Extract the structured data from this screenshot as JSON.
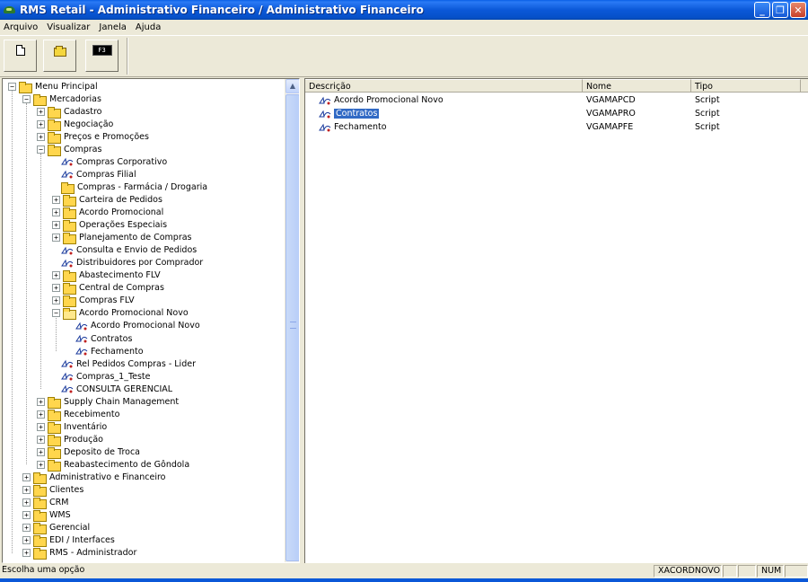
{
  "window": {
    "title": "RMS Retail - Administrativo Financeiro / Administrativo Financeiro",
    "minimize_glyph": "_",
    "maximize_glyph": "❐",
    "close_glyph": "✕"
  },
  "menubar": {
    "items": [
      "Arquivo",
      "Visualizar",
      "Janela",
      "Ajuda"
    ]
  },
  "toolbar": {
    "f3_label": "F3"
  },
  "tree": {
    "expand_glyph": "+",
    "collapse_glyph": "−",
    "scroll_up_glyph": "▲",
    "items": [
      {
        "label": "Menu Principal",
        "level": 0,
        "kind": "folder",
        "state": "expanded"
      },
      {
        "label": "Mercadorias",
        "level": 1,
        "kind": "folder",
        "state": "expanded"
      },
      {
        "label": "Cadastro",
        "level": 2,
        "kind": "folder",
        "state": "collapsed"
      },
      {
        "label": "Negociação",
        "level": 2,
        "kind": "folder",
        "state": "collapsed"
      },
      {
        "label": "Preços e Promoções",
        "level": 2,
        "kind": "folder",
        "state": "collapsed"
      },
      {
        "label": "Compras",
        "level": 2,
        "kind": "folder",
        "state": "expanded"
      },
      {
        "label": "Compras Corporativo",
        "level": 3,
        "kind": "script",
        "state": "leaf"
      },
      {
        "label": "Compras Filial",
        "level": 3,
        "kind": "script",
        "state": "leaf"
      },
      {
        "label": "Compras - Farmácia / Drogaria",
        "level": 3,
        "kind": "folder",
        "state": "leaf"
      },
      {
        "label": "Carteira de Pedidos",
        "level": 3,
        "kind": "folder",
        "state": "collapsed"
      },
      {
        "label": "Acordo Promocional",
        "level": 3,
        "kind": "folder",
        "state": "collapsed"
      },
      {
        "label": "Operações Especiais",
        "level": 3,
        "kind": "folder",
        "state": "collapsed"
      },
      {
        "label": "Planejamento de Compras",
        "level": 3,
        "kind": "folder",
        "state": "collapsed"
      },
      {
        "label": "Consulta e Envio de Pedidos",
        "level": 3,
        "kind": "script",
        "state": "leaf"
      },
      {
        "label": "Distribuidores por Comprador",
        "level": 3,
        "kind": "script",
        "state": "leaf"
      },
      {
        "label": "Abastecimento FLV",
        "level": 3,
        "kind": "folder",
        "state": "collapsed"
      },
      {
        "label": "Central de Compras",
        "level": 3,
        "kind": "folder",
        "state": "collapsed"
      },
      {
        "label": "Compras FLV",
        "level": 3,
        "kind": "folder",
        "state": "collapsed"
      },
      {
        "label": "Acordo Promocional Novo",
        "level": 3,
        "kind": "folder-open",
        "state": "expanded"
      },
      {
        "label": "Acordo Promocional Novo",
        "level": 4,
        "kind": "script",
        "state": "leaf"
      },
      {
        "label": "Contratos",
        "level": 4,
        "kind": "script",
        "state": "leaf"
      },
      {
        "label": "Fechamento",
        "level": 4,
        "kind": "script",
        "state": "leaf"
      },
      {
        "label": "Rel Pedidos Compras - Lider",
        "level": 3,
        "kind": "script",
        "state": "leaf"
      },
      {
        "label": "Compras_1_Teste",
        "level": 3,
        "kind": "script",
        "state": "leaf"
      },
      {
        "label": "CONSULTA GERENCIAL",
        "level": 3,
        "kind": "script",
        "state": "leaf"
      },
      {
        "label": "Supply Chain Management",
        "level": 2,
        "kind": "folder",
        "state": "collapsed"
      },
      {
        "label": "Recebimento",
        "level": 2,
        "kind": "folder",
        "state": "collapsed"
      },
      {
        "label": "Inventário",
        "level": 2,
        "kind": "folder",
        "state": "collapsed"
      },
      {
        "label": "Produção",
        "level": 2,
        "kind": "folder",
        "state": "collapsed"
      },
      {
        "label": "Deposito de Troca",
        "level": 2,
        "kind": "folder",
        "state": "collapsed"
      },
      {
        "label": "Reabastecimento de Gôndola",
        "level": 2,
        "kind": "folder",
        "state": "collapsed"
      },
      {
        "label": "Administrativo e Financeiro",
        "level": 1,
        "kind": "folder",
        "state": "collapsed"
      },
      {
        "label": "Clientes",
        "level": 1,
        "kind": "folder",
        "state": "collapsed"
      },
      {
        "label": "CRM",
        "level": 1,
        "kind": "folder",
        "state": "collapsed"
      },
      {
        "label": "WMS",
        "level": 1,
        "kind": "folder",
        "state": "collapsed"
      },
      {
        "label": "Gerencial",
        "level": 1,
        "kind": "folder",
        "state": "collapsed"
      },
      {
        "label": "EDI / Interfaces",
        "level": 1,
        "kind": "folder",
        "state": "collapsed"
      },
      {
        "label": "RMS - Administrador",
        "level": 1,
        "kind": "folder",
        "state": "collapsed"
      }
    ]
  },
  "list": {
    "columns": [
      "Descrição",
      "Nome",
      "Tipo"
    ],
    "rows": [
      {
        "descricao": "Acordo Promocional Novo",
        "nome": "VGAMAPCD",
        "tipo": "Script",
        "selected": false
      },
      {
        "descricao": "Contratos",
        "nome": "VGAMAPRO",
        "tipo": "Script",
        "selected": true
      },
      {
        "descricao": "Fechamento",
        "nome": "VGAMAPFE",
        "tipo": "Script",
        "selected": false
      }
    ]
  },
  "statusbar": {
    "message": "Escolha uma opção",
    "user": "XACORDNOVO",
    "num": "NUM"
  }
}
